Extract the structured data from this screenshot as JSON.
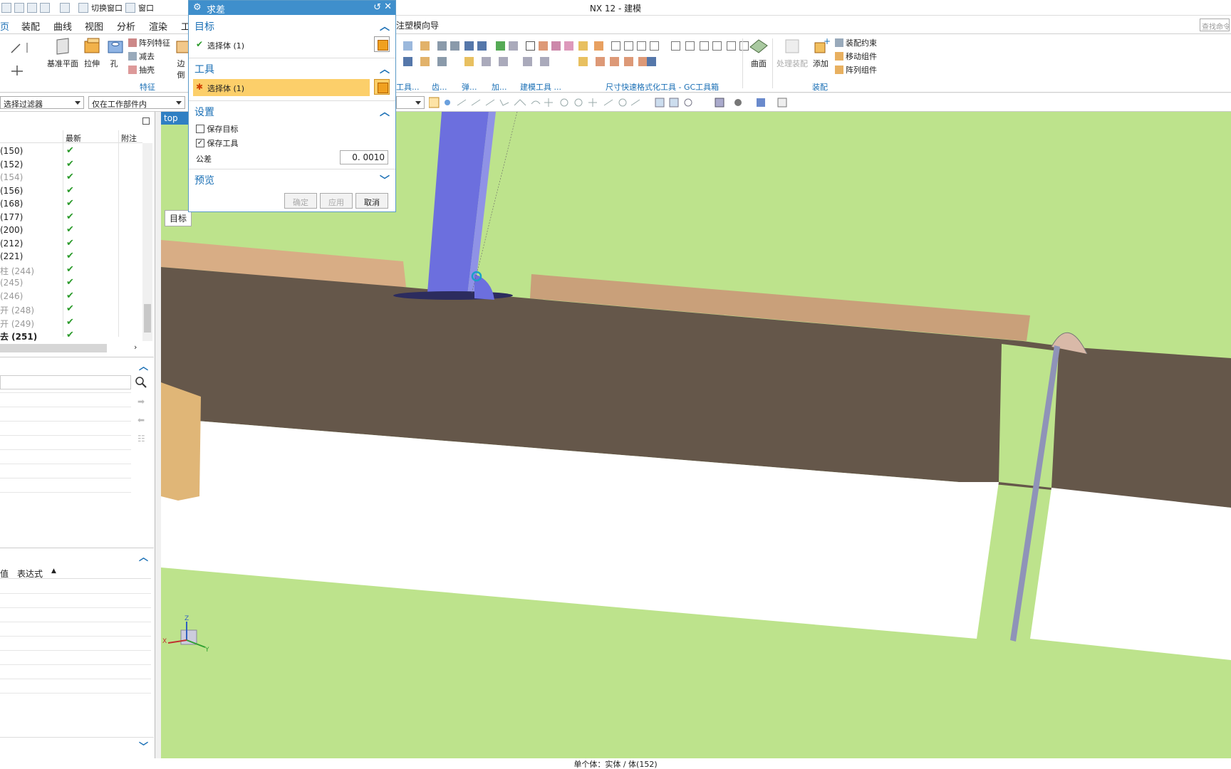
{
  "app": {
    "title": "NX 12 - 建模"
  },
  "quick_access": {
    "switch_window": "切换窗口",
    "window_menu": "窗口"
  },
  "menu": {
    "tabs": [
      "页",
      "装配",
      "曲线",
      "视图",
      "分析",
      "渲染",
      "工"
    ],
    "active_index": 0,
    "extra_tab": "注塑模向导",
    "search_placeholder": "查找命令"
  },
  "ribbon": {
    "datum_plane": "基准平面",
    "extrude": "拉伸",
    "hole": "孔",
    "pattern_feature": "阵列特征",
    "subtract": "减去",
    "shell": "抽壳",
    "edge": "边倒",
    "feature_group": "特征",
    "group_tools": "工具...",
    "group_teeth": "齿...",
    "group_spring": "弹...",
    "group_machining": "加...",
    "group_modeling_tools": "建模工具 ...",
    "group_gc": "尺寸快速格式化工具 - GC工具箱",
    "surface": "曲面",
    "process_assembly": "处理装配",
    "add": "添加",
    "assembly_constraint": "装配约束",
    "move_component": "移动组件",
    "pattern_component": "阵列组件",
    "assembly_group": "装配"
  },
  "filter": {
    "type_filter": "选择过滤器",
    "scope": "仅在工作部件内"
  },
  "navigator": {
    "columns": {
      "latest": "最新",
      "note": "附注"
    },
    "rows": [
      {
        "name": "(150)",
        "grey": false,
        "bold": false
      },
      {
        "name": "(152)",
        "grey": false,
        "bold": false
      },
      {
        "name": "(154)",
        "grey": true,
        "bold": false
      },
      {
        "name": "(156)",
        "grey": false,
        "bold": false
      },
      {
        "name": "(168)",
        "grey": false,
        "bold": false
      },
      {
        "name": "(177)",
        "grey": false,
        "bold": false
      },
      {
        "name": "(200)",
        "grey": false,
        "bold": false
      },
      {
        "name": "(212)",
        "grey": false,
        "bold": false
      },
      {
        "name": "(221)",
        "grey": false,
        "bold": false
      },
      {
        "name": "柱 (244)",
        "grey": true,
        "bold": false
      },
      {
        "name": "(245)",
        "grey": true,
        "bold": false
      },
      {
        "name": "(246)",
        "grey": true,
        "bold": false
      },
      {
        "name": "开 (248)",
        "grey": true,
        "bold": false
      },
      {
        "name": "开 (249)",
        "grey": true,
        "bold": false
      },
      {
        "name": "去 (251)",
        "grey": false,
        "bold": true
      }
    ],
    "checkmark": "✔",
    "lower_columns": {
      "value": "值",
      "expression": "表达式"
    }
  },
  "view": {
    "tab_label": "top",
    "target_label": "目标"
  },
  "dialog": {
    "title": "求差",
    "target_section": "目标",
    "target_select": "选择体 (1)",
    "tool_section": "工具",
    "tool_select": "选择体 (1)",
    "settings_section": "设置",
    "keep_target": "保存目标",
    "keep_target_checked": false,
    "keep_tool": "保存工具",
    "keep_tool_checked": true,
    "tolerance_label": "公差",
    "tolerance_value": "0. 0010",
    "preview_section": "预览",
    "ok": "确定",
    "apply": "应用",
    "cancel": "取消"
  },
  "status": {
    "text": "单个体：实体 / 体(152)"
  },
  "colors": {
    "accent": "#1a6fb5",
    "dialog_title": "#3f8fcc",
    "highlight_row": "#fccf6a",
    "viewport_bg": "#bde38c",
    "body_brown": "#65574a",
    "tube_blue": "#6c6fde"
  },
  "triad": {
    "x": "X",
    "y": "Y",
    "z": "Z"
  }
}
